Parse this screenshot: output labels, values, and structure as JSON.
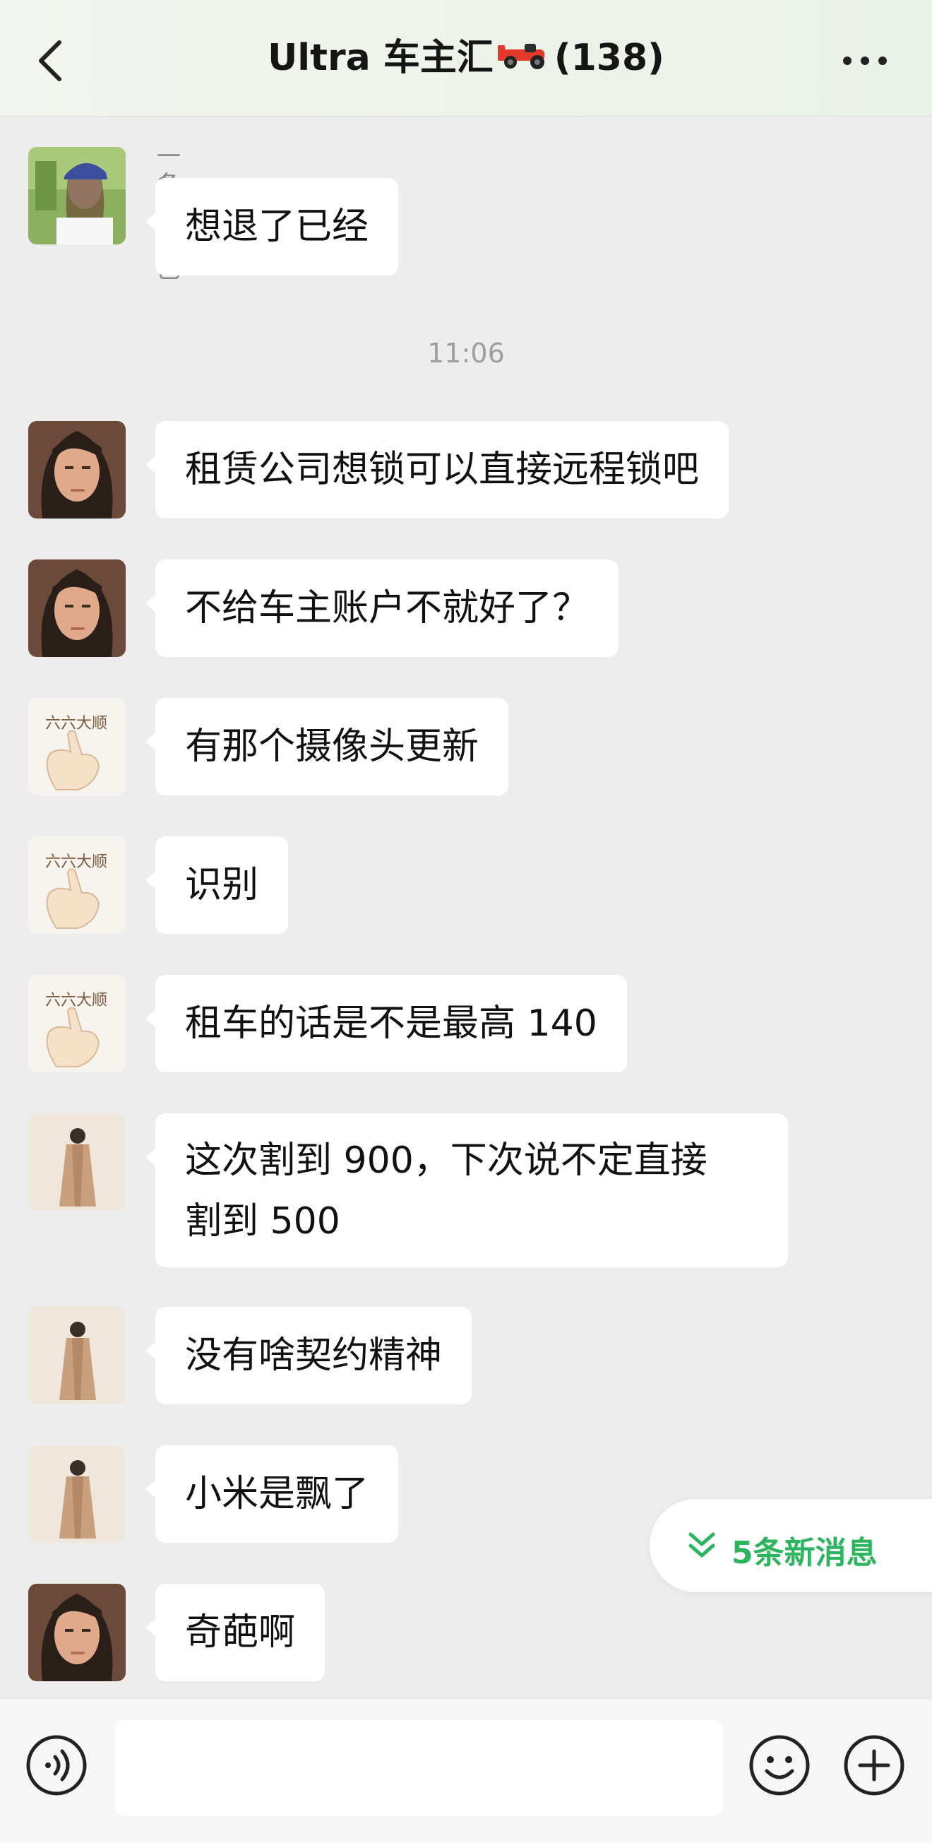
{
  "header": {
    "title": "Ultra 车主汇",
    "member_count": "(138)"
  },
  "timestamp": "11:06",
  "messages": [
    {
      "sender": "一条小尾巴",
      "avatar": "girl-cap-avatar",
      "text": "想退了已经"
    },
    {
      "avatar": "man-portrait-avatar",
      "text": "租赁公司想锁可以直接远程锁吧"
    },
    {
      "avatar": "man-portrait-avatar",
      "text": "不给车主账户不就好了？"
    },
    {
      "avatar": "thumb-hand-avatar",
      "avatar_text": "六六大顺",
      "text": "有那个摄像头更新"
    },
    {
      "avatar": "thumb-hand-avatar",
      "avatar_text": "六六大顺",
      "text": "识别"
    },
    {
      "avatar": "thumb-hand-avatar",
      "avatar_text": "六六大顺",
      "text": "租车的话是不是最高 140"
    },
    {
      "avatar": "coat-figure-avatar",
      "text_line1": "这次割到 900，下次说不定直接",
      "text_line2": "割到 500"
    },
    {
      "avatar": "coat-figure-avatar",
      "text": "没有啥契约精神"
    },
    {
      "avatar": "coat-figure-avatar",
      "text": "小米是飘了"
    },
    {
      "avatar": "man-portrait-avatar",
      "text": "奇葩啊"
    }
  ],
  "new_messages": {
    "label": "5条新消息"
  },
  "input": {
    "value": "",
    "placeholder": ""
  },
  "colors": {
    "accent": "#2CB45E",
    "background": "#EDEDED",
    "bubble": "#FFFFFF"
  }
}
